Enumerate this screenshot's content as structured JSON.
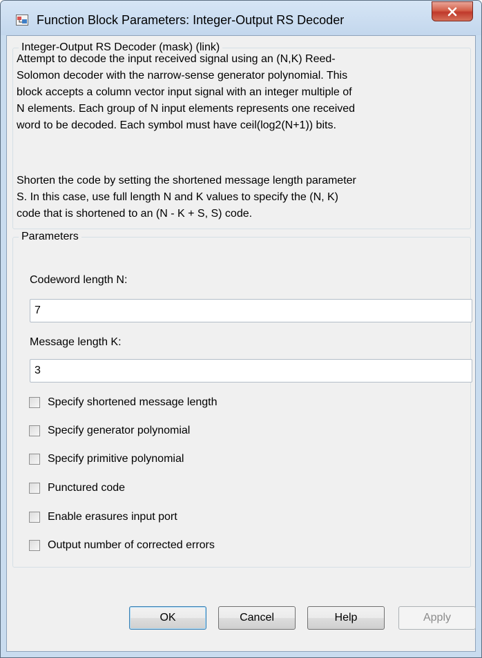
{
  "window": {
    "title": "Function Block Parameters: Integer-Output RS Decoder",
    "icon": "simulink-block-icon",
    "close_icon": "close-icon"
  },
  "description": {
    "legend": "Integer-Output RS Decoder (mask) (link)",
    "paragraph1": [
      "Attempt to decode the input received signal using an (N,K) Reed-",
      "Solomon decoder with the narrow-sense generator polynomial.  This",
      "block accepts a column vector input signal with an integer multiple of",
      "N elements.  Each group of N input elements represents one received",
      "word to be decoded.  Each symbol must have ceil(log2(N+1)) bits."
    ],
    "paragraph2": [
      "Shorten the code by setting the shortened message length parameter",
      "S. In this case, use full length N and K values to specify the (N, K)",
      "code that is shortened to an (N - K + S, S) code."
    ]
  },
  "parameters": {
    "legend": "Parameters",
    "codeword_label": "Codeword length N:",
    "codeword_value": "7",
    "message_label": "Message length K:",
    "message_value": "3",
    "checkboxes": [
      {
        "label": "Specify shortened message length",
        "checked": false
      },
      {
        "label": "Specify generator polynomial",
        "checked": false
      },
      {
        "label": "Specify primitive polynomial",
        "checked": false
      },
      {
        "label": "Punctured code",
        "checked": false
      },
      {
        "label": "Enable erasures input port",
        "checked": false
      },
      {
        "label": "Output number of corrected errors",
        "checked": false
      }
    ]
  },
  "buttons": {
    "ok": "OK",
    "cancel": "Cancel",
    "help": "Help",
    "apply": "Apply"
  }
}
